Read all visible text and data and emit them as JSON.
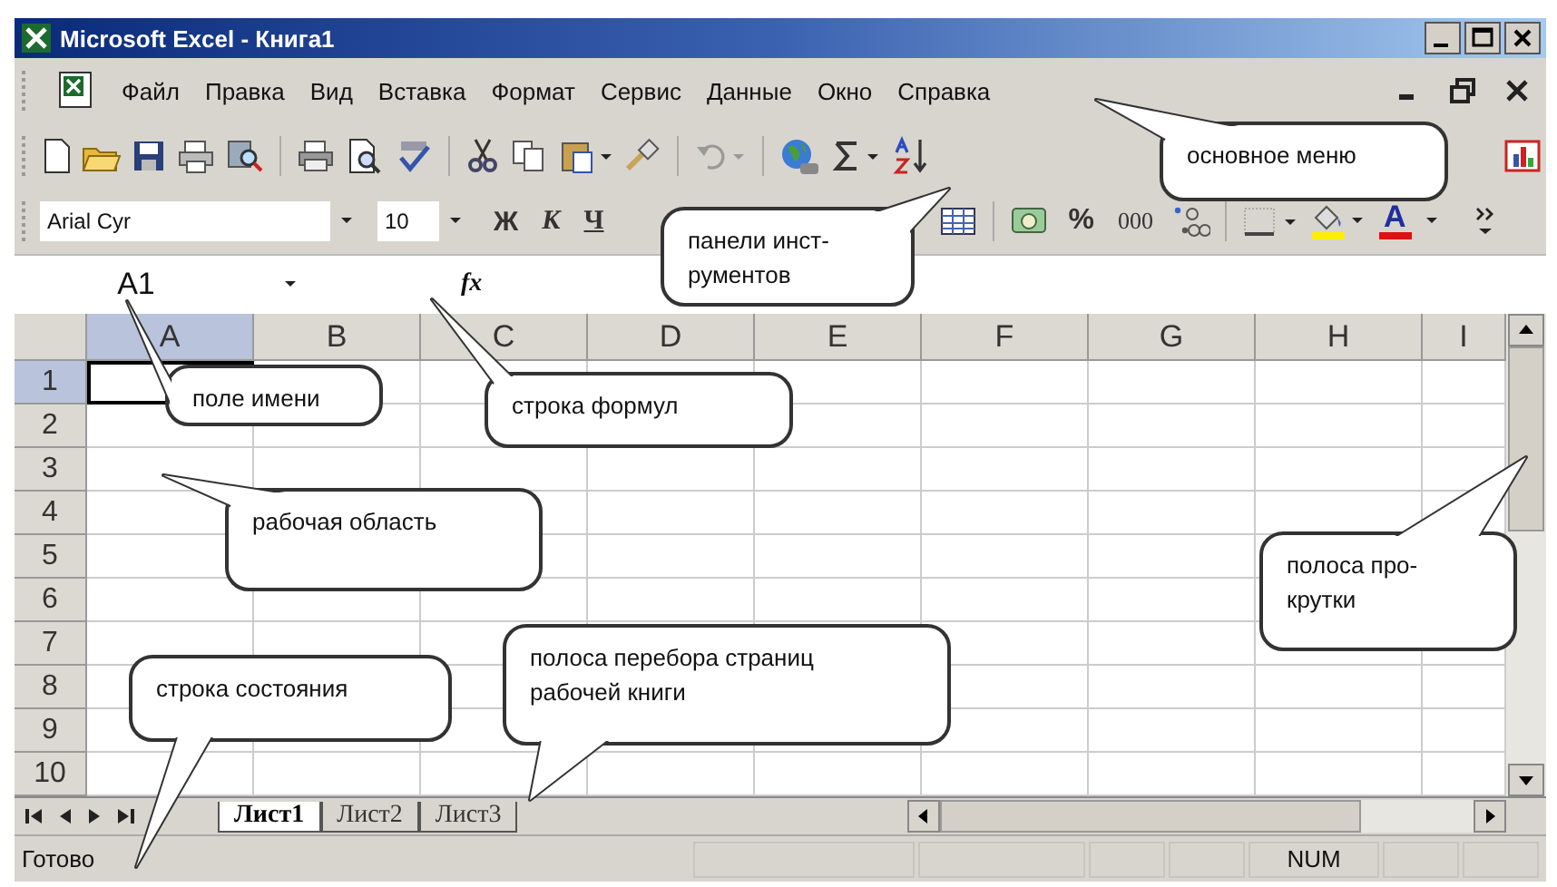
{
  "window": {
    "title": "Microsoft Excel - Книга1"
  },
  "menu": [
    "Файл",
    "Правка",
    "Вид",
    "Вставка",
    "Формат",
    "Сервис",
    "Данные",
    "Окно",
    "Справка"
  ],
  "formatting_toolbar": {
    "font": "Arial Cyr",
    "size": "10",
    "style_buttons": [
      "Ж",
      "К",
      "Ч"
    ],
    "number_buttons": [
      "%",
      "000"
    ],
    "font_color_label": "A"
  },
  "formula_bar": {
    "name_box": "A1",
    "fx_label": "fx"
  },
  "sheet": {
    "columns": [
      {
        "label": "A",
        "selected": true
      },
      {
        "label": "B",
        "selected": false
      },
      {
        "label": "C",
        "selected": false
      },
      {
        "label": "D",
        "selected": false
      },
      {
        "label": "E",
        "selected": false
      },
      {
        "label": "F",
        "selected": false
      },
      {
        "label": "G",
        "selected": false
      },
      {
        "label": "H",
        "selected": false
      },
      {
        "label": "I",
        "selected": false
      }
    ],
    "rows": [
      {
        "label": "1",
        "selected": true
      },
      {
        "label": "2",
        "selected": false
      },
      {
        "label": "3",
        "selected": false
      },
      {
        "label": "4",
        "selected": false
      },
      {
        "label": "5",
        "selected": false
      },
      {
        "label": "6",
        "selected": false
      },
      {
        "label": "7",
        "selected": false
      },
      {
        "label": "8",
        "selected": false
      },
      {
        "label": "9",
        "selected": false
      },
      {
        "label": "10",
        "selected": false
      }
    ]
  },
  "sheet_tabs": [
    {
      "label": "Лист1",
      "selected": true
    },
    {
      "label": "Лист2",
      "selected": false
    },
    {
      "label": "Лист3",
      "selected": false
    }
  ],
  "status_bar": {
    "text": "Готово",
    "indicator": "NUM"
  },
  "callouts": [
    {
      "text": "основное меню"
    },
    {
      "text": "панели инст-\nрументов"
    },
    {
      "text": "поле имени"
    },
    {
      "text": "строка формул"
    },
    {
      "text": "рабочая область"
    },
    {
      "text": "полоса про-\nкрутки"
    },
    {
      "text": "строка состояния"
    },
    {
      "text": "полоса перебора страниц\nрабочей книги"
    }
  ]
}
